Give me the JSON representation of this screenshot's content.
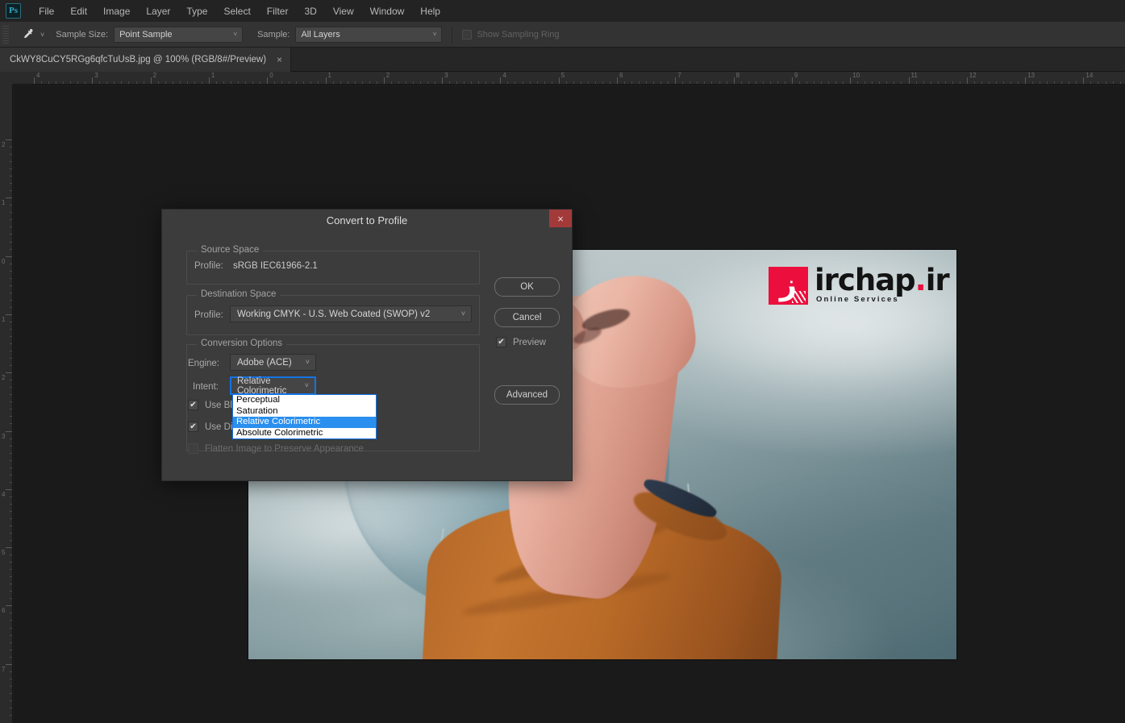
{
  "app": {
    "name": "Adobe Photoshop",
    "logo_text": "Ps"
  },
  "menubar": {
    "items": [
      {
        "label": "File"
      },
      {
        "label": "Edit"
      },
      {
        "label": "Image"
      },
      {
        "label": "Layer"
      },
      {
        "label": "Type"
      },
      {
        "label": "Select"
      },
      {
        "label": "Filter"
      },
      {
        "label": "3D"
      },
      {
        "label": "View"
      },
      {
        "label": "Window"
      },
      {
        "label": "Help"
      }
    ]
  },
  "options_bar": {
    "tool_icon": "eyedropper-icon",
    "tool_caret": "˅",
    "sample_size_label": "Sample Size:",
    "sample_size_value": "Point Sample",
    "sample_label": "Sample:",
    "sample_value": "All Layers",
    "show_sampling_ring_label": "Show Sampling Ring",
    "caret": "˅"
  },
  "document_tab": {
    "title": "CkWY8CuCY5RGg6qfcTuUsB.jpg @ 100% (RGB/8#/Preview)",
    "close": "×"
  },
  "rulers": {
    "horizontal_labels": [
      "4",
      "3",
      "2",
      "1",
      "0",
      "1",
      "2",
      "3",
      "4",
      "5",
      "6",
      "7",
      "8",
      "9",
      "10",
      "11",
      "12",
      "13",
      "14"
    ],
    "vertical_labels": [
      "2",
      "1",
      "0",
      "1",
      "2",
      "3",
      "4",
      "5",
      "6",
      "7"
    ],
    "unit": "inches"
  },
  "watermark": {
    "glyph": "ز",
    "brand": "irchap",
    "tld_dot": ".",
    "tld": "ir",
    "tagline": "Online Services",
    "brand_color": "#ec0f3d"
  },
  "dialog": {
    "title": "Convert to Profile",
    "close_label": "×",
    "source_space": {
      "group_title": "Source Space",
      "profile_label": "Profile:",
      "profile_value": "sRGB IEC61966-2.1"
    },
    "destination_space": {
      "group_title": "Destination Space",
      "profile_label": "Profile:",
      "profile_value": "Working CMYK - U.S. Web Coated (SWOP) v2",
      "caret": "˅"
    },
    "conversion_options": {
      "group_title": "Conversion Options",
      "engine_label": "Engine:",
      "engine_value": "Adobe (ACE)",
      "intent_label": "Intent:",
      "intent_value": "Relative Colorimetric",
      "caret": "˅",
      "intent_options": [
        {
          "label": "Perceptual",
          "selected": false
        },
        {
          "label": "Saturation",
          "selected": false
        },
        {
          "label": "Relative Colorimetric",
          "selected": true
        },
        {
          "label": "Absolute Colorimetric",
          "selected": false
        }
      ],
      "black_point_label": "Use Black Point Compensation",
      "black_point_visible": "Use Bla",
      "black_point_checked": true,
      "dither_label": "Use Dither",
      "dither_visible": "Use Dit",
      "dither_checked": true,
      "flatten_label": "Flatten Image to Preserve Appearance",
      "flatten_checked": false,
      "flatten_enabled": false
    },
    "buttons": {
      "ok": "OK",
      "cancel": "Cancel",
      "advanced": "Advanced",
      "preview_label": "Preview",
      "preview_checked": true,
      "check_mark": "✔"
    },
    "accent_focus_color": "#1473e6",
    "highlight_color": "#2a8fee"
  }
}
